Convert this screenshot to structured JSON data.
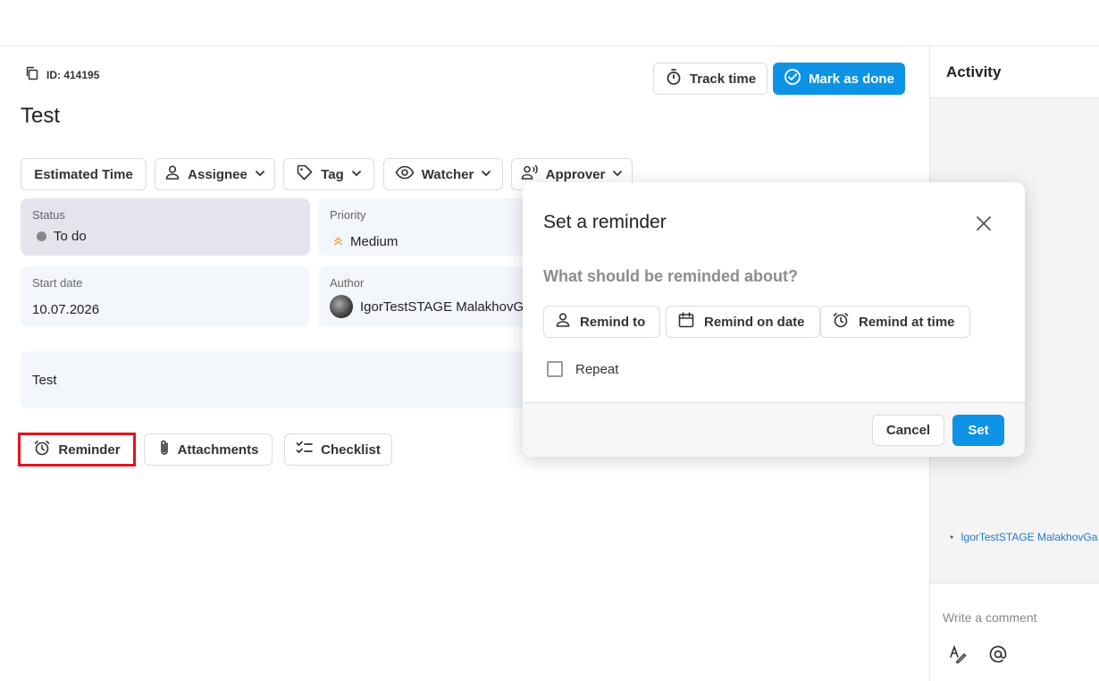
{
  "task": {
    "id_label": "ID: 414195",
    "title": "Test"
  },
  "header_actions": {
    "track_time": "Track time",
    "mark_done": "Mark as done"
  },
  "toolbar": {
    "estimated_time": "Estimated Time",
    "assignee": "Assignee",
    "tag": "Tag",
    "watcher": "Watcher",
    "approver": "Approver"
  },
  "fields": {
    "status_label": "Status",
    "status_value": "To do",
    "priority_label": "Priority",
    "priority_value": "Medium",
    "start_date_label": "Start date",
    "start_date_value": "10.07.2026",
    "author_label": "Author",
    "author_value": "IgorTestSTAGE MalakhovGa"
  },
  "description": "Test",
  "bottom_actions": {
    "reminder": "Reminder",
    "attachments": "Attachments",
    "checklist": "Checklist"
  },
  "activity": {
    "title": "Activity",
    "entry": "IgorTestSTAGE MalakhovGa",
    "comment_placeholder": "Write a comment"
  },
  "reminder_modal": {
    "title": "Set a reminder",
    "question": "What should be reminded about?",
    "remind_to": "Remind to",
    "remind_on_date": "Remind on date",
    "remind_at_time": "Remind at time",
    "repeat": "Repeat",
    "cancel": "Cancel",
    "set": "Set"
  },
  "colors": {
    "accent": "#0d93e6",
    "highlight": "#e0141e",
    "priority_icon": "#f0a13c"
  }
}
